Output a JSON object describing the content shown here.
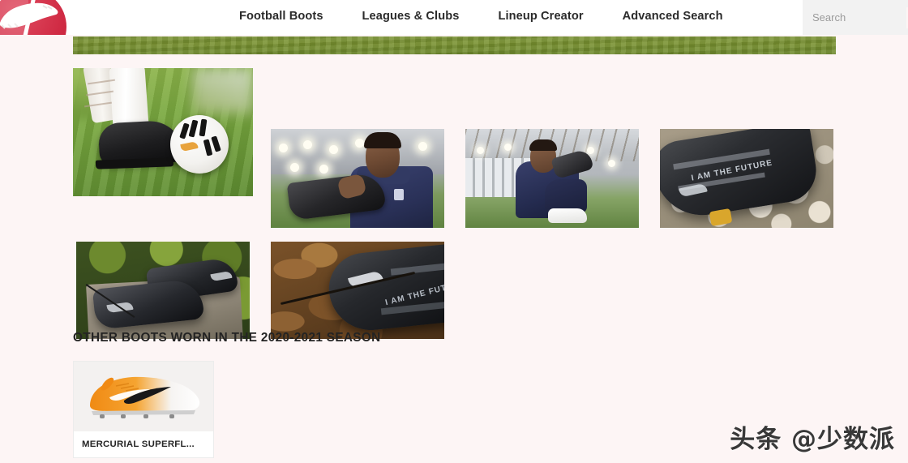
{
  "header": {
    "logo_alt": "football-boot-logo",
    "logo_color": "#d02b44",
    "nav": [
      {
        "label": "Football Boots",
        "name": "nav-football-boots"
      },
      {
        "label": "Leagues & Clubs",
        "name": "nav-leagues-clubs"
      },
      {
        "label": "Lineup Creator",
        "name": "nav-lineup-creator"
      },
      {
        "label": "Advanced Search",
        "name": "nav-advanced-search"
      }
    ],
    "search": {
      "placeholder": "Search",
      "value": "",
      "icon": "search-icon"
    }
  },
  "banner": {
    "name": "grass-banner",
    "color": "#78912f"
  },
  "gallery": {
    "photos": [
      {
        "alt": "black-boot-and-football-on-grass",
        "caption": ""
      },
      {
        "alt": "player-in-navy-kit-holding-black-boot-indoor-pitch",
        "caption": ""
      },
      {
        "alt": "player-seated-on-pitch-holding-boots",
        "caption": ""
      },
      {
        "alt": "black-boot-on-white-stones-i-am-the-future",
        "caption": ""
      },
      {
        "alt": "pair-of-black-boots-on-stone-slab",
        "caption": ""
      },
      {
        "alt": "black-boot-on-autumn-leaves",
        "caption": ""
      }
    ],
    "boot_text_1": "I AM THE FUTURE",
    "boot_text_2": "I AM THE FUTURE"
  },
  "section": {
    "title": "OTHER BOOTS WORN IN THE 2020-2021 SEASON"
  },
  "products": [
    {
      "name": "product-card-mercurial-superfly",
      "label": "MERCURIAL SUPERFL...",
      "image_alt": "orange-white-nike-mercurial-superfly-boot",
      "accent": "#ee8a1e"
    }
  ],
  "watermark": {
    "text": "头条 @少数派"
  }
}
